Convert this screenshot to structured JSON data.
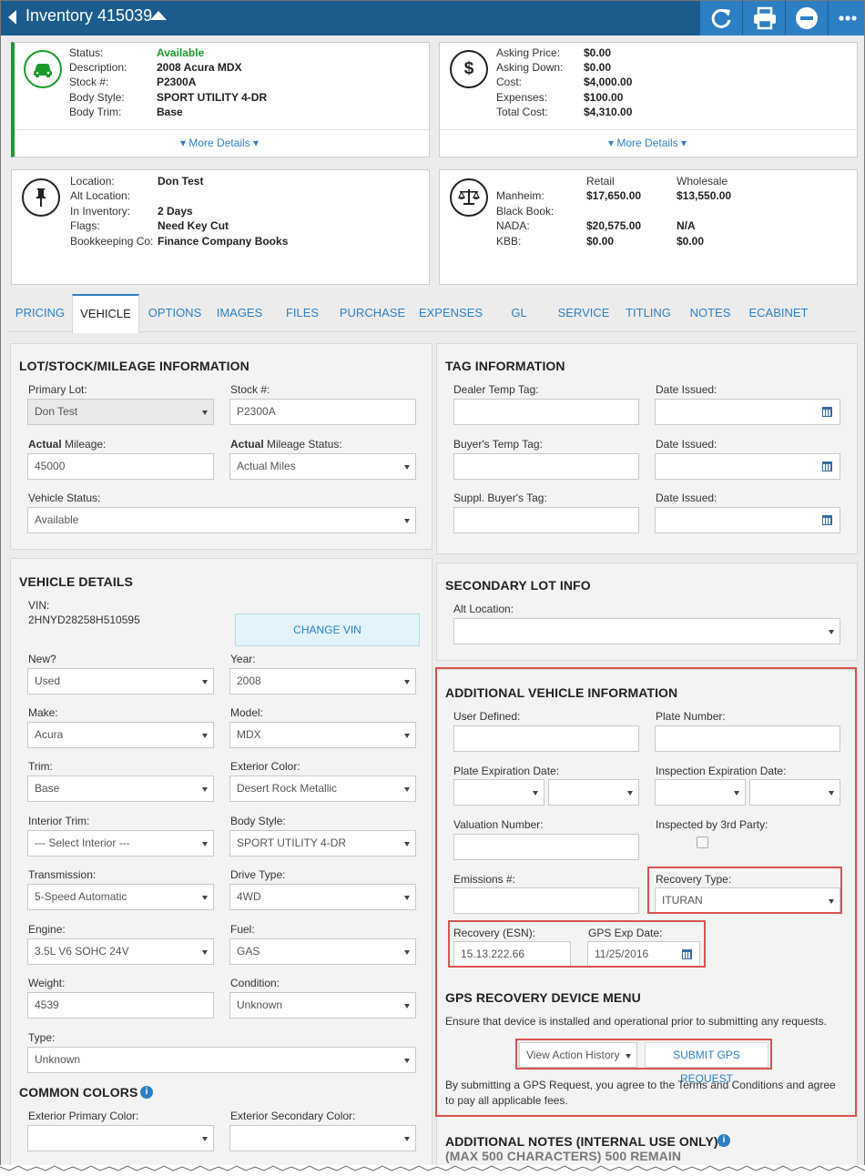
{
  "header": {
    "title": "Inventory 415039"
  },
  "summary": {
    "vehicle": {
      "rows": [
        [
          "Status:",
          "Available"
        ],
        [
          "Description:",
          "2008 Acura MDX"
        ],
        [
          "Stock #:",
          "P2300A"
        ],
        [
          "Body Style:",
          "SPORT UTILITY 4-DR"
        ],
        [
          "Body Trim:",
          "Base"
        ]
      ],
      "more": "More Details"
    },
    "pricing": {
      "rows": [
        [
          "Asking Price:",
          "$0.00"
        ],
        [
          "Asking Down:",
          "$0.00"
        ],
        [
          "Cost:",
          "$4,000.00"
        ],
        [
          "Expenses:",
          "$100.00"
        ],
        [
          "Total Cost:",
          "$4,310.00"
        ]
      ],
      "more": "More Details"
    },
    "location": {
      "rows": [
        [
          "Location:",
          "Don Test"
        ],
        [
          "Alt Location:",
          ""
        ],
        [
          "In Inventory:",
          "2 Days"
        ],
        [
          "Flags:",
          "Need Key Cut"
        ],
        [
          "Bookkeeping Co:",
          "Finance Company Books"
        ]
      ]
    },
    "valuation": {
      "col_retail": "Retail",
      "col_wholesale": "Wholesale",
      "rows": [
        [
          "Manheim:",
          "$17,650.00",
          "$13,550.00"
        ],
        [
          "Black Book:",
          "",
          ""
        ],
        [
          "NADA:",
          "$20,575.00",
          "N/A"
        ],
        [
          "KBB:",
          "$0.00",
          "$0.00"
        ]
      ]
    },
    "status_color": "#1a9a2a"
  },
  "tabs": [
    "PRICING",
    "VEHICLE",
    "OPTIONS",
    "IMAGES",
    "FILES",
    "PURCHASE",
    "EXPENSES",
    "GL",
    "SERVICE",
    "TITLING",
    "NOTES",
    "ECABINET"
  ],
  "lot": {
    "title": "LOT/STOCK/MILEAGE INFORMATION",
    "primary_lot_label": "Primary Lot:",
    "primary_lot": "Don Test",
    "stock_label": "Stock #:",
    "stock": "P2300A",
    "mileage_label_b": "Actual",
    "mileage_label": " Mileage:",
    "mileage": "45000",
    "mileage_status_label_b": "Actual",
    "mileage_status_label": " Mileage Status:",
    "mileage_status": "Actual Miles",
    "vehicle_status_label": "Vehicle Status:",
    "vehicle_status": "Available"
  },
  "tag": {
    "title": "TAG INFORMATION",
    "dealer_temp": "Dealer Temp Tag:",
    "buyers_temp": "Buyer's Temp Tag:",
    "suppl_buyers": "Suppl. Buyer's Tag:",
    "date_issued": "Date Issued:"
  },
  "details": {
    "title": "VEHICLE DETAILS",
    "vin_label": "VIN:",
    "vin": "2HNYD28258H510595",
    "change_vin": "CHANGE VIN",
    "new_label": "New?",
    "new": "Used",
    "year_label": "Year:",
    "year": "2008",
    "make_label": "Make:",
    "make": "Acura",
    "model_label": "Model:",
    "model": "MDX",
    "trim_label": "Trim:",
    "trim": "Base",
    "ext_color_label": "Exterior Color:",
    "ext_color": "Desert Rock Metallic",
    "int_trim_label": "Interior Trim:",
    "int_trim": "--- Select Interior ---",
    "body_label": "Body Style:",
    "body": "SPORT UTILITY 4-DR",
    "trans_label": "Transmission:",
    "trans": "5-Speed Automatic",
    "drive_label": "Drive Type:",
    "drive": "4WD",
    "engine_label": "Engine:",
    "engine": "3.5L V6 SOHC 24V",
    "fuel_label": "Fuel:",
    "fuel": "GAS",
    "weight_label": "Weight:",
    "weight": "4539",
    "condition_label": "Condition:",
    "condition": "Unknown",
    "type_label": "Type:",
    "type": "Unknown"
  },
  "colors": {
    "title": "COMMON COLORS",
    "primary_label": "Exterior Primary Color:",
    "secondary_label": "Exterior Secondary Color:"
  },
  "secondary": {
    "title": "SECONDARY LOT INFO",
    "alt_label": "Alt Location:"
  },
  "additional": {
    "title": "ADDITIONAL VEHICLE INFORMATION",
    "user_defined": "User Defined:",
    "plate_number": "Plate Number:",
    "plate_exp": "Plate Expiration Date:",
    "insp_exp": "Inspection Expiration Date:",
    "valuation_num": "Valuation Number:",
    "inspected_3rd": "Inspected by 3rd Party:",
    "emissions": "Emissions #:",
    "recovery_type_label": "Recovery Type:",
    "recovery_type": "ITURAN",
    "recovery_esn_label": "Recovery (ESN):",
    "recovery_esn": "15.13.222.66",
    "gps_exp_label": "GPS Exp Date:",
    "gps_exp": "11/25/2016"
  },
  "gps": {
    "title": "GPS RECOVERY DEVICE MENU",
    "note": "Ensure that device is installed and operational prior to submitting any requests.",
    "history": "View Action History",
    "submit": "SUBMIT GPS REQUEST",
    "terms": "By submitting a GPS Request, you agree to the Terms and Conditions and agree to pay all applicable fees."
  },
  "notes": {
    "title": "ADDITIONAL NOTES (INTERNAL USE ONLY):",
    "subtitle": "(MAX 500 CHARACTERS) 500 REMAIN"
  }
}
